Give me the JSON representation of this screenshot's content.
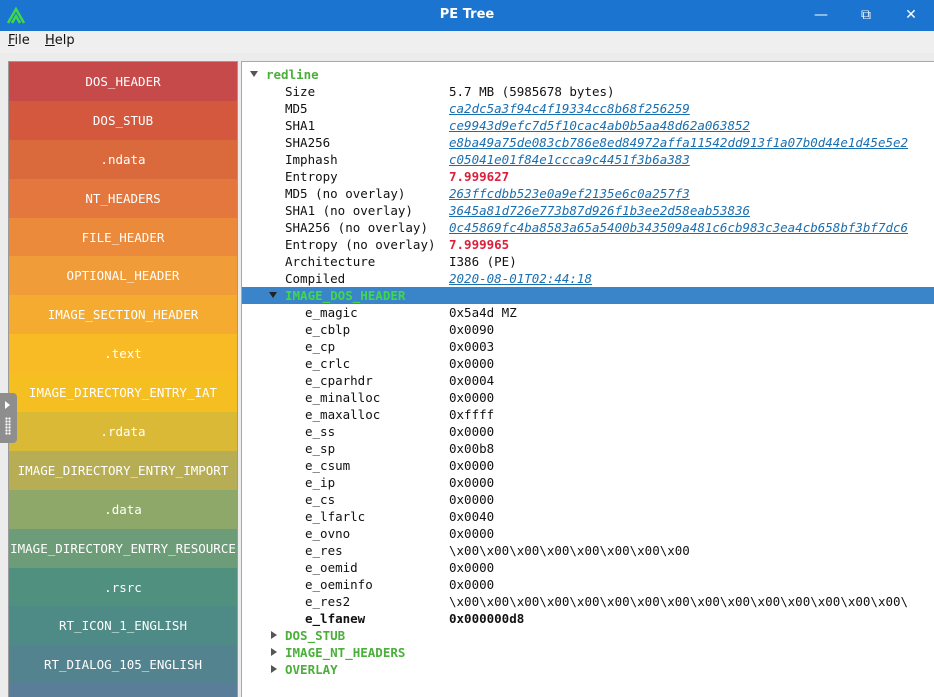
{
  "window": {
    "title": "PE Tree",
    "logo_color": "#3fd84a",
    "titlebar_color": "#1a74d0"
  },
  "menu": {
    "file": "File",
    "help": "Help"
  },
  "sections": [
    {
      "label": "DOS_HEADER",
      "color": "#c74a4a"
    },
    {
      "label": "DOS_STUB",
      "color": "#d3583e"
    },
    {
      "label": "·ndata",
      "color": "#da6a3c"
    },
    {
      "label": "NT_HEADERS",
      "color": "#e3773e"
    },
    {
      "label": "FILE_HEADER",
      "color": "#ea8a3a"
    },
    {
      "label": "OPTIONAL_HEADER",
      "color": "#f09c38"
    },
    {
      "label": "IMAGE_SECTION_HEADER",
      "color": "#f4ab30"
    },
    {
      "label": ".text",
      "color": "#f8bb26"
    },
    {
      "label": "IMAGE_DIRECTORY_ENTRY_IAT",
      "color": "#f5be21"
    },
    {
      "label": ".rdata",
      "color": "#dab936"
    },
    {
      "label": "IMAGE_DIRECTORY_ENTRY_IMPORT",
      "color": "#b7ad55"
    },
    {
      "label": ".data",
      "color": "#8ea86a"
    },
    {
      "label": "IMAGE_DIRECTORY_ENTRY_RESOURCE",
      "color": "#6d9c78"
    },
    {
      "label": ".rsrc",
      "color": "#50907f"
    },
    {
      "label": "RT_ICON_1_ENGLISH",
      "color": "#4e8a86"
    },
    {
      "label": "RT_DIALOG_105_ENGLISH",
      "color": "#52838e"
    },
    {
      "label": "",
      "color": "#5a7d9a"
    }
  ],
  "tree": {
    "root": "redline",
    "file_info": [
      {
        "key": "Size",
        "value": "5.7 MB (5985678 bytes)",
        "style": "plain"
      },
      {
        "key": "MD5",
        "value": "ca2dc5a3f94c4f19334cc8b68f256259",
        "style": "link"
      },
      {
        "key": "SHA1",
        "value": "ce9943d9efc7d5f10cac4ab0b5aa48d62a063852",
        "style": "link"
      },
      {
        "key": "SHA256",
        "value": "e8ba49a75de083cb786e8ed84972affa11542dd913f1a07b0d44e1d45e5e2",
        "style": "link"
      },
      {
        "key": "Imphash",
        "value": "c05041e01f84e1ccca9c4451f3b6a383",
        "style": "link"
      },
      {
        "key": "Entropy",
        "value": "7.999627",
        "style": "red"
      },
      {
        "key": "MD5 (no overlay)",
        "value": "263ffcdbb523e0a9ef2135e6c0a257f3",
        "style": "link"
      },
      {
        "key": "SHA1 (no overlay)",
        "value": "3645a81d726e773b87d926f1b3ee2d58eab53836",
        "style": "link"
      },
      {
        "key": "SHA256 (no overlay)",
        "value": "0c45869fc4ba8583a65a5400b343509a481c6cb983c3ea4cb658bf3bf7dc6",
        "style": "link"
      },
      {
        "key": "Entropy (no overlay)",
        "value": "7.999965",
        "style": "red"
      },
      {
        "key": "Architecture",
        "value": "I386 (PE)",
        "style": "plain"
      },
      {
        "key": "Compiled",
        "value": "2020-08-01T02:44:18",
        "style": "link"
      }
    ],
    "dos_header": {
      "label": "IMAGE_DOS_HEADER",
      "fields": [
        {
          "key": "e_magic",
          "value": "0x5a4d MZ"
        },
        {
          "key": "e_cblp",
          "value": "0x0090"
        },
        {
          "key": "e_cp",
          "value": "0x0003"
        },
        {
          "key": "e_crlc",
          "value": "0x0000"
        },
        {
          "key": "e_cparhdr",
          "value": "0x0004"
        },
        {
          "key": "e_minalloc",
          "value": "0x0000"
        },
        {
          "key": "e_maxalloc",
          "value": "0xffff"
        },
        {
          "key": "e_ss",
          "value": "0x0000"
        },
        {
          "key": "e_sp",
          "value": "0x00b8"
        },
        {
          "key": "e_csum",
          "value": "0x0000"
        },
        {
          "key": "e_ip",
          "value": "0x0000"
        },
        {
          "key": "e_cs",
          "value": "0x0000"
        },
        {
          "key": "e_lfarlc",
          "value": "0x0040"
        },
        {
          "key": "e_ovno",
          "value": "0x0000"
        },
        {
          "key": "e_res",
          "value": "\\x00\\x00\\x00\\x00\\x00\\x00\\x00\\x00"
        },
        {
          "key": "e_oemid",
          "value": "0x0000"
        },
        {
          "key": "e_oeminfo",
          "value": "0x0000"
        },
        {
          "key": "e_res2",
          "value": "\\x00\\x00\\x00\\x00\\x00\\x00\\x00\\x00\\x00\\x00\\x00\\x00\\x00\\x00\\x00\\"
        },
        {
          "key": "e_lfanew",
          "value": "0x000000d8",
          "bold": true
        }
      ]
    },
    "collapsed": [
      "DOS_STUB",
      "IMAGE_NT_HEADERS",
      "OVERLAY"
    ]
  }
}
